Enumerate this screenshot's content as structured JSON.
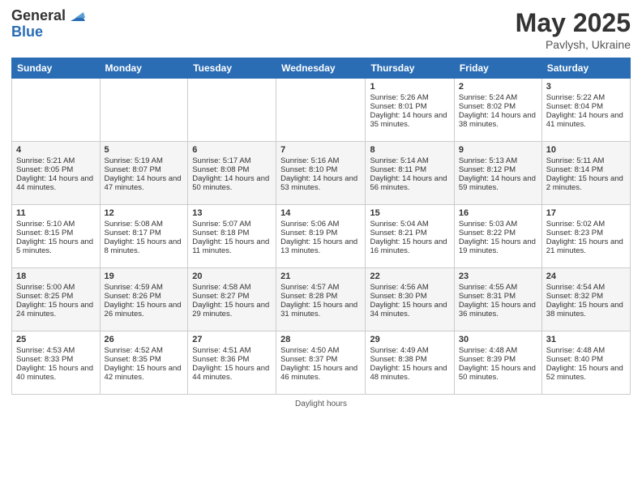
{
  "logo": {
    "general": "General",
    "blue": "Blue"
  },
  "title": {
    "month": "May 2025",
    "location": "Pavlysh, Ukraine"
  },
  "weekdays": [
    "Sunday",
    "Monday",
    "Tuesday",
    "Wednesday",
    "Thursday",
    "Friday",
    "Saturday"
  ],
  "weeks": [
    [
      {
        "day": "",
        "sunrise": "",
        "sunset": "",
        "daylight": ""
      },
      {
        "day": "",
        "sunrise": "",
        "sunset": "",
        "daylight": ""
      },
      {
        "day": "",
        "sunrise": "",
        "sunset": "",
        "daylight": ""
      },
      {
        "day": "",
        "sunrise": "",
        "sunset": "",
        "daylight": ""
      },
      {
        "day": "1",
        "sunrise": "Sunrise: 5:26 AM",
        "sunset": "Sunset: 8:01 PM",
        "daylight": "Daylight: 14 hours and 35 minutes."
      },
      {
        "day": "2",
        "sunrise": "Sunrise: 5:24 AM",
        "sunset": "Sunset: 8:02 PM",
        "daylight": "Daylight: 14 hours and 38 minutes."
      },
      {
        "day": "3",
        "sunrise": "Sunrise: 5:22 AM",
        "sunset": "Sunset: 8:04 PM",
        "daylight": "Daylight: 14 hours and 41 minutes."
      }
    ],
    [
      {
        "day": "4",
        "sunrise": "Sunrise: 5:21 AM",
        "sunset": "Sunset: 8:05 PM",
        "daylight": "Daylight: 14 hours and 44 minutes."
      },
      {
        "day": "5",
        "sunrise": "Sunrise: 5:19 AM",
        "sunset": "Sunset: 8:07 PM",
        "daylight": "Daylight: 14 hours and 47 minutes."
      },
      {
        "day": "6",
        "sunrise": "Sunrise: 5:17 AM",
        "sunset": "Sunset: 8:08 PM",
        "daylight": "Daylight: 14 hours and 50 minutes."
      },
      {
        "day": "7",
        "sunrise": "Sunrise: 5:16 AM",
        "sunset": "Sunset: 8:10 PM",
        "daylight": "Daylight: 14 hours and 53 minutes."
      },
      {
        "day": "8",
        "sunrise": "Sunrise: 5:14 AM",
        "sunset": "Sunset: 8:11 PM",
        "daylight": "Daylight: 14 hours and 56 minutes."
      },
      {
        "day": "9",
        "sunrise": "Sunrise: 5:13 AM",
        "sunset": "Sunset: 8:12 PM",
        "daylight": "Daylight: 14 hours and 59 minutes."
      },
      {
        "day": "10",
        "sunrise": "Sunrise: 5:11 AM",
        "sunset": "Sunset: 8:14 PM",
        "daylight": "Daylight: 15 hours and 2 minutes."
      }
    ],
    [
      {
        "day": "11",
        "sunrise": "Sunrise: 5:10 AM",
        "sunset": "Sunset: 8:15 PM",
        "daylight": "Daylight: 15 hours and 5 minutes."
      },
      {
        "day": "12",
        "sunrise": "Sunrise: 5:08 AM",
        "sunset": "Sunset: 8:17 PM",
        "daylight": "Daylight: 15 hours and 8 minutes."
      },
      {
        "day": "13",
        "sunrise": "Sunrise: 5:07 AM",
        "sunset": "Sunset: 8:18 PM",
        "daylight": "Daylight: 15 hours and 11 minutes."
      },
      {
        "day": "14",
        "sunrise": "Sunrise: 5:06 AM",
        "sunset": "Sunset: 8:19 PM",
        "daylight": "Daylight: 15 hours and 13 minutes."
      },
      {
        "day": "15",
        "sunrise": "Sunrise: 5:04 AM",
        "sunset": "Sunset: 8:21 PM",
        "daylight": "Daylight: 15 hours and 16 minutes."
      },
      {
        "day": "16",
        "sunrise": "Sunrise: 5:03 AM",
        "sunset": "Sunset: 8:22 PM",
        "daylight": "Daylight: 15 hours and 19 minutes."
      },
      {
        "day": "17",
        "sunrise": "Sunrise: 5:02 AM",
        "sunset": "Sunset: 8:23 PM",
        "daylight": "Daylight: 15 hours and 21 minutes."
      }
    ],
    [
      {
        "day": "18",
        "sunrise": "Sunrise: 5:00 AM",
        "sunset": "Sunset: 8:25 PM",
        "daylight": "Daylight: 15 hours and 24 minutes."
      },
      {
        "day": "19",
        "sunrise": "Sunrise: 4:59 AM",
        "sunset": "Sunset: 8:26 PM",
        "daylight": "Daylight: 15 hours and 26 minutes."
      },
      {
        "day": "20",
        "sunrise": "Sunrise: 4:58 AM",
        "sunset": "Sunset: 8:27 PM",
        "daylight": "Daylight: 15 hours and 29 minutes."
      },
      {
        "day": "21",
        "sunrise": "Sunrise: 4:57 AM",
        "sunset": "Sunset: 8:28 PM",
        "daylight": "Daylight: 15 hours and 31 minutes."
      },
      {
        "day": "22",
        "sunrise": "Sunrise: 4:56 AM",
        "sunset": "Sunset: 8:30 PM",
        "daylight": "Daylight: 15 hours and 34 minutes."
      },
      {
        "day": "23",
        "sunrise": "Sunrise: 4:55 AM",
        "sunset": "Sunset: 8:31 PM",
        "daylight": "Daylight: 15 hours and 36 minutes."
      },
      {
        "day": "24",
        "sunrise": "Sunrise: 4:54 AM",
        "sunset": "Sunset: 8:32 PM",
        "daylight": "Daylight: 15 hours and 38 minutes."
      }
    ],
    [
      {
        "day": "25",
        "sunrise": "Sunrise: 4:53 AM",
        "sunset": "Sunset: 8:33 PM",
        "daylight": "Daylight: 15 hours and 40 minutes."
      },
      {
        "day": "26",
        "sunrise": "Sunrise: 4:52 AM",
        "sunset": "Sunset: 8:35 PM",
        "daylight": "Daylight: 15 hours and 42 minutes."
      },
      {
        "day": "27",
        "sunrise": "Sunrise: 4:51 AM",
        "sunset": "Sunset: 8:36 PM",
        "daylight": "Daylight: 15 hours and 44 minutes."
      },
      {
        "day": "28",
        "sunrise": "Sunrise: 4:50 AM",
        "sunset": "Sunset: 8:37 PM",
        "daylight": "Daylight: 15 hours and 46 minutes."
      },
      {
        "day": "29",
        "sunrise": "Sunrise: 4:49 AM",
        "sunset": "Sunset: 8:38 PM",
        "daylight": "Daylight: 15 hours and 48 minutes."
      },
      {
        "day": "30",
        "sunrise": "Sunrise: 4:48 AM",
        "sunset": "Sunset: 8:39 PM",
        "daylight": "Daylight: 15 hours and 50 minutes."
      },
      {
        "day": "31",
        "sunrise": "Sunrise: 4:48 AM",
        "sunset": "Sunset: 8:40 PM",
        "daylight": "Daylight: 15 hours and 52 minutes."
      }
    ]
  ],
  "footer": {
    "daylight_label": "Daylight hours"
  }
}
